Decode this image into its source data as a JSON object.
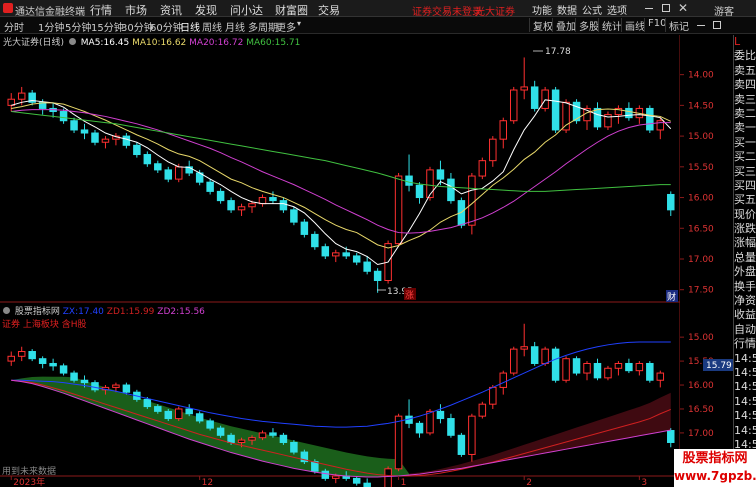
{
  "app": {
    "title": "通达信金融终端",
    "menu": [
      "行情",
      "市场",
      "资讯",
      "发现",
      "问小达",
      "财富圈",
      "交易"
    ],
    "login_status": "证券交易未登录",
    "broker": "光大证券",
    "right_menu": [
      "功能",
      "数据",
      "公式",
      "选项"
    ],
    "guest": "游客",
    "window_controls": [
      "minimize-icon",
      "maximize-icon",
      "close-icon"
    ]
  },
  "toolbar": {
    "periods": [
      "分时",
      "1分钟",
      "5分钟",
      "15分钟",
      "30分钟",
      "60分钟",
      "日线",
      "周线",
      "月线",
      "多周期",
      "更多"
    ],
    "active_period": "日线",
    "right_buttons": [
      "复权",
      "叠加",
      "多股",
      "统计",
      "画线",
      "F10",
      "标记"
    ],
    "right_icons": [
      "minus-icon",
      "restore-icon"
    ]
  },
  "main_chart": {
    "stock_label": "光大证券(日线)",
    "ma": [
      {
        "label": "MA5:",
        "value": "16.45",
        "color": "#ffffff"
      },
      {
        "label": "MA10:",
        "value": "16.62",
        "color": "#e8d86a"
      },
      {
        "label": "MA20:",
        "value": "16.72",
        "color": "#d040d0"
      },
      {
        "label": "MA60:",
        "value": "15.71",
        "color": "#40c040"
      }
    ],
    "y_ticks": [
      "17.50",
      "17.00",
      "16.50",
      "16.00",
      "15.50",
      "15.00",
      "14.50",
      "14.00"
    ],
    "high_label": "17.78",
    "low_label": "13.95",
    "marker_zhang": "涨",
    "marker_cai": "财"
  },
  "sub_chart": {
    "indicator_name": "股票指标网",
    "lines": [
      {
        "label": "ZX:",
        "value": "17.40",
        "color": "#2040ff"
      },
      {
        "label": "ZD1:",
        "value": "15.99",
        "color": "#d02020"
      },
      {
        "label": "ZD2:",
        "value": "15.56",
        "color": "#d040d0"
      }
    ],
    "subtitle": "证券 上海板块 含H股",
    "y_ticks": [
      "17.50",
      "17.00",
      "16.50",
      "16.00",
      "15.50",
      "15.00"
    ],
    "current_value": "15.79",
    "footer": "用到未来数据"
  },
  "x_axis": [
    "2023年",
    "12",
    "1",
    "2",
    "3"
  ],
  "sidebar": {
    "items": [
      "L",
      "委比",
      "卖五",
      "卖四",
      "卖三",
      "卖二",
      "卖一",
      "买一",
      "买二",
      "买三",
      "买四",
      "买五",
      "现价",
      "涨跌",
      "涨幅",
      "总量",
      "外盘",
      "换手",
      "净资",
      "收益",
      "自动",
      "行情",
      "14:50",
      "14:50",
      "14:50",
      "14:50",
      "14:50",
      "14:50",
      "14:50",
      "14:50",
      "14:50"
    ]
  },
  "watermark": {
    "line1": "股票指标网",
    "line2": "www.7gpzb.com"
  },
  "chart_data": [
    {
      "type": "candlestick",
      "title": "光大证券(日线)",
      "ylim": [
        13.8,
        17.95
      ],
      "y_ticks": [
        14.0,
        14.5,
        15.0,
        15.5,
        16.0,
        16.5,
        17.0,
        17.5
      ],
      "ohlc": [
        [
          17.0,
          17.2,
          16.9,
          17.1
        ],
        [
          17.1,
          17.3,
          17.0,
          17.2
        ],
        [
          17.2,
          17.25,
          17.0,
          17.05
        ],
        [
          17.05,
          17.1,
          16.85,
          16.95
        ],
        [
          16.95,
          17.05,
          16.8,
          16.9
        ],
        [
          16.9,
          16.95,
          16.7,
          16.75
        ],
        [
          16.75,
          16.8,
          16.55,
          16.6
        ],
        [
          16.6,
          16.7,
          16.45,
          16.55
        ],
        [
          16.55,
          16.6,
          16.35,
          16.4
        ],
        [
          16.4,
          16.5,
          16.3,
          16.45
        ],
        [
          16.45,
          16.55,
          16.35,
          16.5
        ],
        [
          16.5,
          16.55,
          16.3,
          16.35
        ],
        [
          16.35,
          16.4,
          16.15,
          16.2
        ],
        [
          16.2,
          16.25,
          16.0,
          16.05
        ],
        [
          16.05,
          16.1,
          15.9,
          15.95
        ],
        [
          15.95,
          16.0,
          15.75,
          15.8
        ],
        [
          15.8,
          16.05,
          15.75,
          16.0
        ],
        [
          16.0,
          16.1,
          15.85,
          15.9
        ],
        [
          15.9,
          15.95,
          15.7,
          15.75
        ],
        [
          15.75,
          15.8,
          15.55,
          15.6
        ],
        [
          15.6,
          15.65,
          15.4,
          15.45
        ],
        [
          15.45,
          15.5,
          15.25,
          15.3
        ],
        [
          15.3,
          15.4,
          15.2,
          15.35
        ],
        [
          15.35,
          15.45,
          15.25,
          15.4
        ],
        [
          15.4,
          15.55,
          15.35,
          15.5
        ],
        [
          15.5,
          15.6,
          15.4,
          15.45
        ],
        [
          15.45,
          15.5,
          15.25,
          15.3
        ],
        [
          15.3,
          15.35,
          15.05,
          15.1
        ],
        [
          15.1,
          15.15,
          14.85,
          14.9
        ],
        [
          14.9,
          14.95,
          14.65,
          14.7
        ],
        [
          14.7,
          14.75,
          14.5,
          14.55
        ],
        [
          14.55,
          14.65,
          14.45,
          14.6
        ],
        [
          14.6,
          14.7,
          14.5,
          14.55
        ],
        [
          14.55,
          14.6,
          14.4,
          14.45
        ],
        [
          14.45,
          14.55,
          14.25,
          14.3
        ],
        [
          14.3,
          14.35,
          13.95,
          14.15
        ],
        [
          14.15,
          14.8,
          14.1,
          14.75
        ],
        [
          14.75,
          15.9,
          14.7,
          15.85
        ],
        [
          15.85,
          16.2,
          15.6,
          15.7
        ],
        [
          15.7,
          15.75,
          15.4,
          15.5
        ],
        [
          15.5,
          16.0,
          15.45,
          15.95
        ],
        [
          15.95,
          16.1,
          15.7,
          15.8
        ],
        [
          15.8,
          15.9,
          15.4,
          15.45
        ],
        [
          15.45,
          15.5,
          15.0,
          15.05
        ],
        [
          15.05,
          15.9,
          14.9,
          15.85
        ],
        [
          15.85,
          16.15,
          15.8,
          16.1
        ],
        [
          16.1,
          16.5,
          16.0,
          16.45
        ],
        [
          16.45,
          16.8,
          16.3,
          16.75
        ],
        [
          16.75,
          17.3,
          16.7,
          17.25
        ],
        [
          17.25,
          17.78,
          17.1,
          17.3
        ],
        [
          17.3,
          17.4,
          16.9,
          16.95
        ],
        [
          16.95,
          17.3,
          16.9,
          17.25
        ],
        [
          17.25,
          17.3,
          16.55,
          16.6
        ],
        [
          16.6,
          17.1,
          16.55,
          17.05
        ],
        [
          17.05,
          17.1,
          16.7,
          16.75
        ],
        [
          16.75,
          17.0,
          16.6,
          16.95
        ],
        [
          16.95,
          17.05,
          16.6,
          16.65
        ],
        [
          16.65,
          16.9,
          16.6,
          16.85
        ],
        [
          16.85,
          17.0,
          16.7,
          16.95
        ],
        [
          16.95,
          17.05,
          16.75,
          16.8
        ],
        [
          16.8,
          17.0,
          16.7,
          16.95
        ],
        [
          16.95,
          17.0,
          16.55,
          16.6
        ],
        [
          16.6,
          16.8,
          16.45,
          16.75
        ],
        [
          15.55,
          15.6,
          15.2,
          15.3
        ]
      ],
      "series": [
        {
          "name": "MA5",
          "color": "#ffffff",
          "values": [
            17.0,
            17.05,
            17.08,
            17.06,
            17.04,
            16.97,
            16.85,
            16.74,
            16.65,
            16.55,
            16.49,
            16.45,
            16.4,
            16.31,
            16.19,
            16.08,
            16.0,
            15.99,
            15.9,
            15.8,
            15.71,
            15.6,
            15.5,
            15.43,
            15.4,
            15.4,
            15.4,
            15.35,
            15.25,
            15.09,
            14.91,
            14.75,
            14.66,
            14.62,
            14.54,
            14.41,
            14.45,
            14.71,
            14.96,
            15.24,
            15.55,
            15.76,
            15.68,
            15.56,
            15.62,
            15.65,
            15.77,
            15.92,
            16.28,
            16.6,
            16.83,
            17.09,
            17.07,
            17.04,
            16.98,
            16.92,
            16.85,
            16.81,
            16.82,
            16.84,
            16.85,
            16.83,
            16.8,
            16.62
          ],
          "ymin": 14.2,
          "ymax": 17.4
        },
        {
          "name": "MA10",
          "color": "#e8d86a",
          "values": [
            16.95,
            16.98,
            17.02,
            17.04,
            17.04,
            17.02,
            16.96,
            16.9,
            16.83,
            16.76,
            16.68,
            16.6,
            16.52,
            16.45,
            16.37,
            16.28,
            16.21,
            16.17,
            16.1,
            16.0,
            15.9,
            15.8,
            15.74,
            15.66,
            15.6,
            15.55,
            15.5,
            15.42,
            15.34,
            15.24,
            15.14,
            15.05,
            14.98,
            14.93,
            14.83,
            14.73,
            14.68,
            14.72,
            14.8,
            14.87,
            14.97,
            15.1,
            15.19,
            15.26,
            15.4,
            15.55,
            15.7,
            15.82,
            15.96,
            16.12,
            16.24,
            16.4,
            16.52,
            16.68,
            16.78,
            16.88,
            16.93,
            16.94,
            16.93,
            16.9,
            16.87,
            16.84,
            16.82,
            16.74
          ],
          "ymin": 14.4,
          "ymax": 17.3
        },
        {
          "name": "MA20",
          "color": "#d040d0",
          "values": [
            16.9,
            16.92,
            16.93,
            16.93,
            16.93,
            16.92,
            16.9,
            16.88,
            16.85,
            16.82,
            16.78,
            16.74,
            16.7,
            16.65,
            16.6,
            16.54,
            16.48,
            16.42,
            16.36,
            16.3,
            16.23,
            16.15,
            16.08,
            16.0,
            15.92,
            15.85,
            15.78,
            15.71,
            15.63,
            15.55,
            15.47,
            15.38,
            15.3,
            15.22,
            15.14,
            15.05,
            14.98,
            14.93,
            14.92,
            14.93,
            14.95,
            14.98,
            15.01,
            15.06,
            15.11,
            15.17,
            15.25,
            15.34,
            15.44,
            15.56,
            15.68,
            15.8,
            15.92,
            16.05,
            16.17,
            16.29,
            16.4,
            16.5,
            16.58,
            16.64,
            16.68,
            16.7,
            16.72,
            16.72
          ],
          "ymin": 14.9,
          "ymax": 16.95
        },
        {
          "name": "MA60",
          "color": "#40c040",
          "values": [
            16.9,
            16.88,
            16.86,
            16.84,
            16.82,
            16.8,
            16.78,
            16.76,
            16.74,
            16.72,
            16.7,
            16.67,
            16.64,
            16.61,
            16.58,
            16.55,
            16.52,
            16.49,
            16.46,
            16.43,
            16.4,
            16.37,
            16.34,
            16.31,
            16.28,
            16.25,
            16.22,
            16.19,
            16.16,
            16.13,
            16.1,
            16.06,
            16.02,
            15.98,
            15.94,
            15.9,
            15.85,
            15.8,
            15.75,
            15.72,
            15.7,
            15.68,
            15.67,
            15.66,
            15.65,
            15.64,
            15.63,
            15.62,
            15.61,
            15.6,
            15.6,
            15.6,
            15.61,
            15.62,
            15.63,
            15.64,
            15.65,
            15.66,
            15.67,
            15.68,
            15.69,
            15.7,
            15.71,
            15.71
          ],
          "ymin": 15.5,
          "ymax": 16.95
        }
      ]
    },
    {
      "type": "line",
      "title": "股票指标网",
      "ylim": [
        14.6,
        17.9
      ],
      "y_ticks": [
        15.0,
        15.5,
        16.0,
        16.5,
        17.0,
        17.5
      ],
      "series": [
        {
          "name": "ZX",
          "color": "#2040ff",
          "values": [
            16.6,
            16.6,
            16.59,
            16.58,
            16.57,
            16.55,
            16.52,
            16.49,
            16.45,
            16.41,
            16.37,
            16.32,
            16.27,
            16.22,
            16.17,
            16.12,
            16.07,
            16.02,
            15.97,
            15.92,
            15.88,
            15.84,
            15.8,
            15.77,
            15.74,
            15.72,
            15.7,
            15.68,
            15.66,
            15.64,
            15.63,
            15.62,
            15.62,
            15.63,
            15.64,
            15.67,
            15.7,
            15.74,
            15.79,
            15.85,
            15.92,
            16.0,
            16.08,
            16.17,
            16.26,
            16.35,
            16.45,
            16.55,
            16.65,
            16.75,
            16.85,
            16.95,
            17.04,
            17.12,
            17.19,
            17.25,
            17.3,
            17.34,
            17.37,
            17.39,
            17.4,
            17.4,
            17.4,
            17.4
          ]
        },
        {
          "name": "ZD1",
          "color": "#d02020",
          "values": [
            16.6,
            16.58,
            16.55,
            16.5,
            16.44,
            16.38,
            16.31,
            16.24,
            16.17,
            16.1,
            16.03,
            15.96,
            15.89,
            15.82,
            15.75,
            15.68,
            15.61,
            15.54,
            15.47,
            15.41,
            15.35,
            15.29,
            15.24,
            15.19,
            15.14,
            15.09,
            15.04,
            14.99,
            14.94,
            14.89,
            14.84,
            14.79,
            14.74,
            14.7,
            14.66,
            14.63,
            14.61,
            14.6,
            14.6,
            14.61,
            14.63,
            14.66,
            14.7,
            14.74,
            14.79,
            14.84,
            14.89,
            14.95,
            15.01,
            15.07,
            15.13,
            15.19,
            15.25,
            15.31,
            15.37,
            15.43,
            15.49,
            15.55,
            15.61,
            15.67,
            15.73,
            15.8,
            15.9,
            15.99
          ]
        },
        {
          "name": "ZD2",
          "color": "#d040d0",
          "values": [
            16.6,
            16.57,
            16.53,
            16.47,
            16.4,
            16.33,
            16.25,
            16.17,
            16.09,
            16.01,
            15.93,
            15.85,
            15.77,
            15.69,
            15.61,
            15.53,
            15.45,
            15.37,
            15.3,
            15.23,
            15.16,
            15.09,
            15.03,
            14.97,
            14.91,
            14.86,
            14.81,
            14.76,
            14.72,
            14.68,
            14.65,
            14.62,
            14.6,
            14.59,
            14.58,
            14.58,
            14.59,
            14.6,
            14.62,
            14.64,
            14.67,
            14.7,
            14.73,
            14.76,
            14.8,
            14.84,
            14.88,
            14.92,
            14.96,
            15.0,
            15.04,
            15.08,
            15.12,
            15.16,
            15.2,
            15.24,
            15.28,
            15.32,
            15.36,
            15.4,
            15.44,
            15.48,
            15.52,
            15.56
          ]
        }
      ],
      "candles": "same_as_main"
    }
  ]
}
